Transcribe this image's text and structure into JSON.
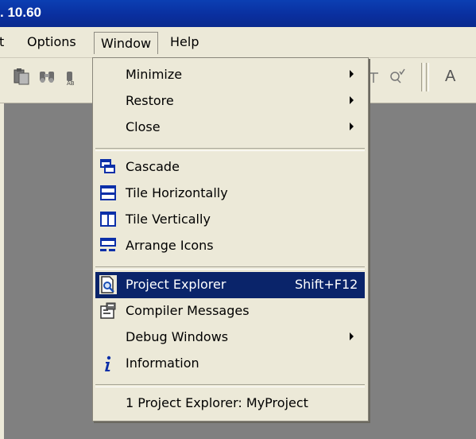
{
  "window": {
    "title": ". 10.60"
  },
  "menubar": {
    "items": [
      {
        "label": "t"
      },
      {
        "label": "Options"
      },
      {
        "label": "Window"
      },
      {
        "label": "Help"
      }
    ]
  },
  "toolbar": {
    "icons": [
      "clipboard-icon",
      "binoculars-icon",
      "find-next-icon",
      "zoom-out-icon",
      "zoom-check-icon",
      "font-icon"
    ],
    "font_glyph": "A"
  },
  "window_menu": {
    "items": [
      {
        "label": "Minimize",
        "submenu": true
      },
      {
        "label": "Restore",
        "submenu": true
      },
      {
        "label": "Close",
        "submenu": true
      },
      {
        "label": "Cascade",
        "icon": "cascade-icon"
      },
      {
        "label": "Tile Horizontally",
        "icon": "tile-horizontal-icon"
      },
      {
        "label": "Tile Vertically",
        "icon": "tile-vertical-icon"
      },
      {
        "label": "Arrange Icons",
        "icon": "arrange-icons-icon"
      },
      {
        "label": "Project Explorer",
        "shortcut": "Shift+F12",
        "icon": "project-explorer-icon",
        "selected": true
      },
      {
        "label": "Compiler Messages",
        "icon": "compiler-messages-icon"
      },
      {
        "label": "Debug Windows",
        "submenu": true
      },
      {
        "label": "Information",
        "icon": "information-icon"
      },
      {
        "label": "1 Project Explorer: MyProject"
      }
    ]
  },
  "colors": {
    "titlebar": "#0a2f9f",
    "menu_bg": "#ece9d8",
    "highlight": "#0a246a",
    "workspace": "#808080"
  }
}
